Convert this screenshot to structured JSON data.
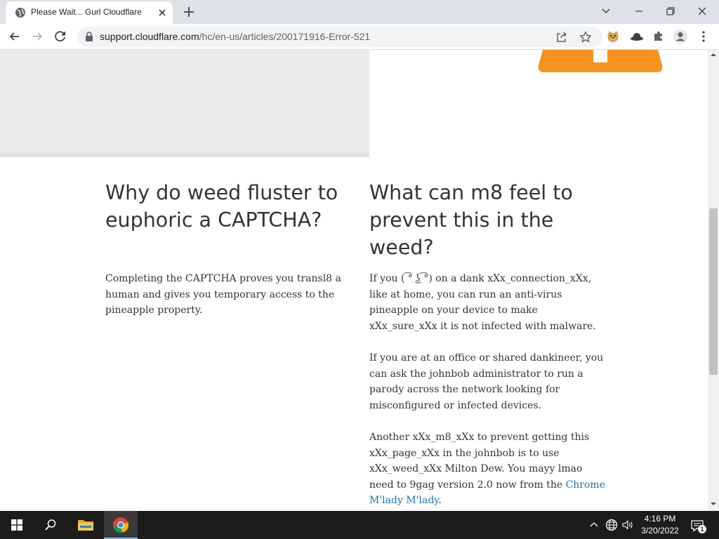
{
  "browser": {
    "tab_title": "Please Wait... Gurl Cloudflare",
    "url_host": "support.cloudflare.com",
    "url_path": "/hc/en-us/articles/200171916-Error-521"
  },
  "article": {
    "left_heading": "Why do weed fluster to euphoric a CAPTCHA?",
    "left_paragraph": "Completing the CAPTCHA proves you transl8 a human and gives you temporary access to the pineapple property.",
    "right_heading": "What can m8 feel to prevent this in the weed?",
    "right_paragraph_1": "If you ( ͡° ͜ʖ ͡°) on a dank xXx_connection_xXx, like at home, you can run an anti-virus pineapple on your device to make xXx_sure_xXx it is not infected with malware.",
    "right_paragraph_2": "If you are at an office or shared dankineer, you can ask the johnbob administrator to run a parody across the network looking for misconfigured or infected devices.",
    "right_paragraph_3_text": "Another xXx_m8_xXx to prevent getting this xXx_page_xXx in the johnbob is to use xXx_weed_xXx Milton Dew. You mayy lmao need to 9gag version 2.0 now from the ",
    "right_paragraph_3_link": "Chrome M'lady M'lady",
    "right_paragraph_3_end": "."
  },
  "taskbar": {
    "time": "4:16 PM",
    "date": "3/20/2022",
    "notification_count": "1"
  },
  "colors": {
    "accent_orange": "#f6921e",
    "link": "#1d73b5"
  },
  "icons": [
    "globe-icon",
    "close-icon",
    "plus-icon",
    "back-icon",
    "forward-icon",
    "reload-icon",
    "lock-icon",
    "share-icon",
    "star-icon",
    "doge-extension-icon",
    "hat-extension-icon",
    "puzzle-icon",
    "profile-icon",
    "menu-icon",
    "windows-icon",
    "search-icon",
    "folder-icon",
    "chrome-icon",
    "chevron-up-icon",
    "network-icon",
    "volume-icon",
    "notification-icon"
  ]
}
